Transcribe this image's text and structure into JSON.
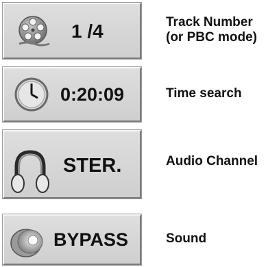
{
  "rows": [
    {
      "value": "1 /4",
      "icon": "film-reel-icon",
      "label_lines": [
        "Track Number",
        "(or PBC mode)"
      ]
    },
    {
      "value": "0:20:09",
      "icon": "clock-icon",
      "label_lines": [
        "Time search"
      ]
    },
    {
      "value": "STER.",
      "icon": "headphones-icon",
      "label_lines": [
        "Audio Channel"
      ]
    },
    {
      "value": "BYPASS",
      "icon": "speaker-icon",
      "label_lines": [
        "Sound"
      ]
    }
  ]
}
